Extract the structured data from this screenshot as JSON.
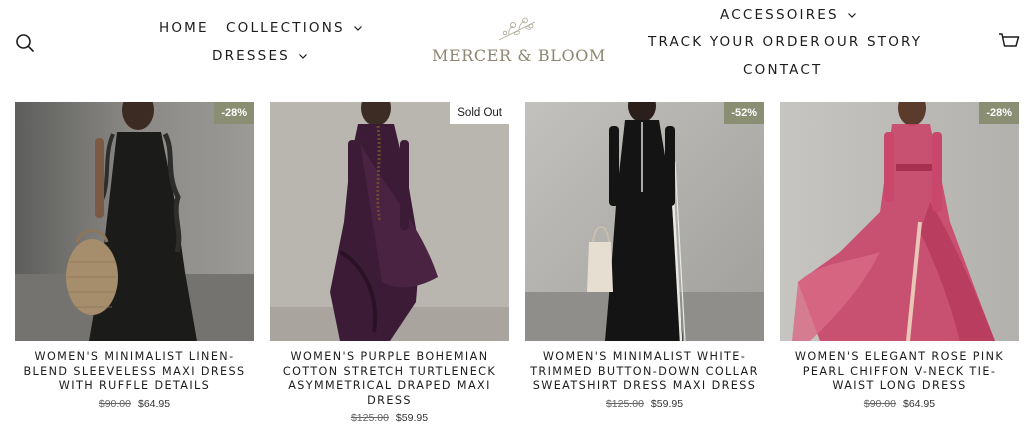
{
  "brand": {
    "name": "MERCER & BLOOM"
  },
  "nav": {
    "home": "HOME",
    "collections": "COLLECTIONS",
    "dresses": "DRESSES",
    "accessoires": "ACCESSOIRES",
    "track": "TRACK YOUR ORDER",
    "story": "OUR STORY",
    "contact": "CONTACT"
  },
  "colors": {
    "accent": "#8a8f74",
    "text": "#1c1c1c",
    "logo": "#8d8672"
  },
  "products": [
    {
      "title": "Women's Minimalist Linen-Blend Sleeveless Maxi Dress With Ruffle Details",
      "badge": "-28%",
      "old_price": "$90.00",
      "price": "$64.95",
      "image": "model in black sleeveless ruffle maxi dress with woven bag"
    },
    {
      "title": "Women's Purple Bohemian Cotton Stretch Turtleneck Asymmetrical Draped Maxi Dress",
      "badge": "Sold Out",
      "old_price": "$125.00",
      "price": "$59.95",
      "image": "model in purple draped turtleneck maxi dress"
    },
    {
      "title": "Women's Minimalist White-Trimmed Button-Down Collar Sweatshirt Dress Maxi Dress",
      "badge": "-52%",
      "old_price": "$125.00",
      "price": "$59.95",
      "image": "model in black collared maxi dress with white trim"
    },
    {
      "title": "Women's Elegant Rose Pink Pearl Chiffon V-Neck Tie-Waist Long Dress",
      "badge": "-28%",
      "old_price": "$90.00",
      "price": "$64.95",
      "image": "model in flowing rose pink chiffon dress"
    }
  ]
}
